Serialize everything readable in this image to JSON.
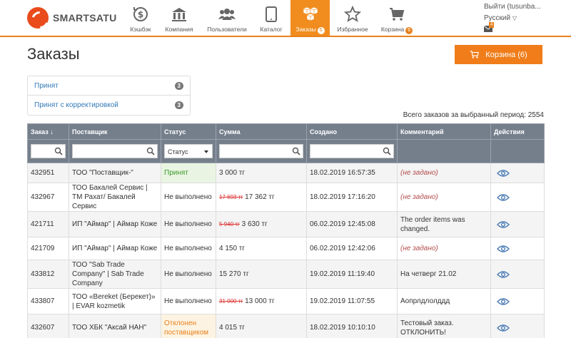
{
  "brand": {
    "name": "SMARTSATU"
  },
  "nav": [
    {
      "label": "Кэшбэк",
      "icon": "cashback-icon",
      "active": false
    },
    {
      "label": "Компания",
      "icon": "bank-icon",
      "active": false
    },
    {
      "label": "Пользователи",
      "icon": "users-icon",
      "active": false
    },
    {
      "label": "Каталог",
      "icon": "tablet-icon",
      "active": false
    },
    {
      "label": "Заказы",
      "icon": "boxes-icon",
      "active": true,
      "badge": "6"
    },
    {
      "label": "Избранное",
      "icon": "star-icon",
      "active": false
    },
    {
      "label": "Корзина",
      "icon": "cart-icon",
      "active": false,
      "badge": "6"
    }
  ],
  "user": {
    "logout": "Выйти (tusunba...",
    "language": "Русский",
    "mail_count": "4"
  },
  "page": {
    "title": "Заказы",
    "cart_button": "Корзина (6)",
    "total": "Всего заказов за выбранный период: 2554"
  },
  "status_list": [
    {
      "label": "Принят",
      "count": "3"
    },
    {
      "label": "Принят с корректировкой",
      "count": "3"
    }
  ],
  "table": {
    "columns": [
      "Заказ",
      "Поставщик",
      "Статус",
      "Сумма",
      "Создано",
      "Комментарий",
      "Действия"
    ],
    "status_filter": "Статус",
    "rows": [
      {
        "id": "432951",
        "supplier": "ТОО \"Поставщик-\"",
        "status": "Принят",
        "status_type": "accepted",
        "old_sum": "",
        "sum": "3 000 тг",
        "created": "18.02.2019 16:57:35",
        "comment": "(не задано)",
        "comment_empty": true
      },
      {
        "id": "432967",
        "supplier": "ТОО Бакалей Сервис | ТМ Рахат/ Бакалей Сервис",
        "status": "Не выполнено",
        "status_type": "normal",
        "old_sum": "17 693 тг",
        "sum": "17 362 тг",
        "created": "18.02.2019 17:16:20",
        "comment": "(не задано)",
        "comment_empty": true
      },
      {
        "id": "421711",
        "supplier": "ИП \"Аймар\" | Аймар Коже",
        "status": "Не выполнено",
        "status_type": "normal",
        "old_sum": "5 940 тг",
        "sum": "3 630 тг",
        "created": "06.02.2019 12:45:08",
        "comment": "The order items was changed.",
        "comment_empty": false
      },
      {
        "id": "421709",
        "supplier": "ИП \"Аймар\" | Аймар Коже",
        "status": "Не выполнено",
        "status_type": "normal",
        "old_sum": "",
        "sum": "4 150 тг",
        "created": "06.02.2019 12:42:06",
        "comment": "(не задано)",
        "comment_empty": true
      },
      {
        "id": "433812",
        "supplier": "ТОО \"Sab Trade Company\" | Sab Trade Company",
        "status": "Не выполнено",
        "status_type": "normal",
        "old_sum": "",
        "sum": "15 270 тг",
        "created": "19.02.2019 11:19:40",
        "comment": "На четверг 21.02",
        "comment_empty": false
      },
      {
        "id": "433807",
        "supplier": "ТОО «Bereket (Берекет)» | EVAR kozmetik",
        "status": "Не выполнено",
        "status_type": "normal",
        "old_sum": "31 000 тг",
        "sum": "13 000 тг",
        "created": "19.02.2019 11:07:55",
        "comment": "Аопрлдлолддд",
        "comment_empty": false
      },
      {
        "id": "432607",
        "supplier": "ТОО ХБК \"Аксай НАН\"",
        "status": "Отклонен поставщиком",
        "status_type": "rejected",
        "old_sum": "",
        "sum": "4 015 тг",
        "created": "18.02.2019 10:10:10",
        "comment": "Тестовый заказ. ОТКЛОНИТЬ!",
        "comment_empty": false
      }
    ]
  }
}
